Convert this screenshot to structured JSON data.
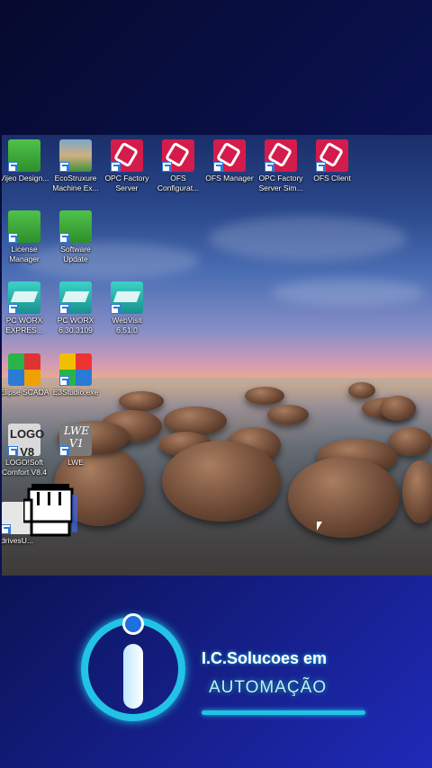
{
  "desktop": {
    "icons": [
      {
        "id": "vijeo",
        "label": "Vijeo Design...",
        "icon": "vijeo-designer-icon"
      },
      {
        "id": "ecostruxure",
        "label": "EcoStruxure Machine Ex...",
        "icon": "ecostruxure-icon"
      },
      {
        "id": "opc-factory-server",
        "label": "OPC Factory Server",
        "icon": "opc-factory-server-icon"
      },
      {
        "id": "ofs-config",
        "label": "OFS Configurat...",
        "icon": "ofs-configurator-icon"
      },
      {
        "id": "ofs-manager",
        "label": "OFS Manager",
        "icon": "ofs-manager-icon"
      },
      {
        "id": "opc-factory-sim",
        "label": "OPC Factory Server Sim...",
        "icon": "opc-factory-server-sim-icon"
      },
      {
        "id": "ofs-client",
        "label": "OFS Client",
        "icon": "ofs-client-icon"
      },
      {
        "id": "license-manager",
        "label": "License Manager",
        "icon": "license-manager-icon"
      },
      {
        "id": "software-update",
        "label": "Software Update",
        "icon": "software-update-icon"
      },
      {
        "id": "pc-worx-express",
        "label": "PC WORX EXPRES...",
        "icon": "pc-worx-express-icon"
      },
      {
        "id": "pc-worx",
        "label": "PC WORX 6.30.3109",
        "icon": "pc-worx-icon"
      },
      {
        "id": "webvisit",
        "label": "WebVisit 6.51.0",
        "icon": "webvisit-icon"
      },
      {
        "id": "elipse-scada",
        "label": "Elipse SCADA",
        "icon": "elipse-scada-icon"
      },
      {
        "id": "e3studio",
        "label": "E3Studio.exe",
        "icon": "e3studio-icon"
      },
      {
        "id": "logo-soft",
        "label": "LOGO!Soft Comfort V8.4",
        "icon": "logo-soft-icon",
        "glyph": "LOGO V8"
      },
      {
        "id": "lwe",
        "label": "LWE",
        "icon": "lwe-icon",
        "glyph": "LWE V1"
      },
      {
        "id": "drives",
        "label": "drivesU...",
        "icon": "drives-icon"
      }
    ]
  },
  "brand": {
    "name": "I.C.Solucoes em",
    "tagline": "AUTOMAÇÃO",
    "accent_color": "#21c3e6"
  }
}
